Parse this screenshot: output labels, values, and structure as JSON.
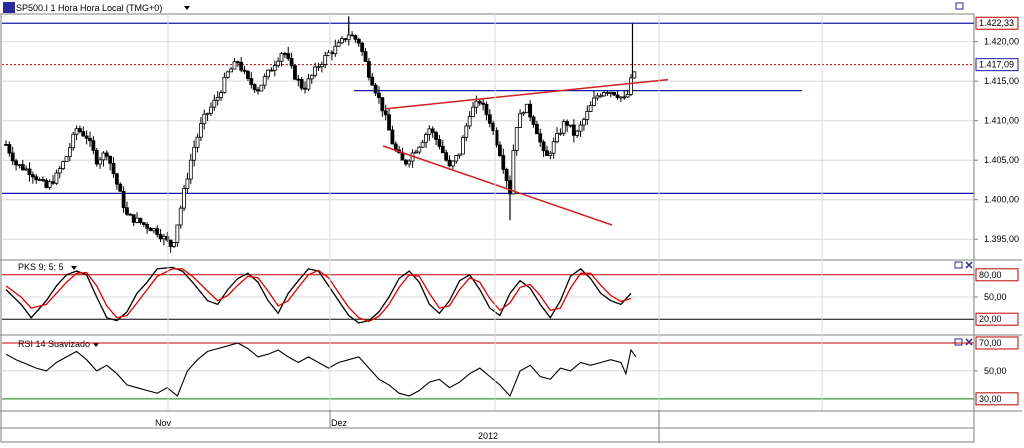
{
  "colors": {
    "grid": "#d8d8d8",
    "frame": "#808080",
    "candle": "#000000",
    "sma": "#e00000",
    "support": "#1a1aa8",
    "trend": "#d02020",
    "level_red": "#c00000",
    "level_green": "#008000",
    "label_blue": "#1a1aa8",
    "label_red": "#c00000",
    "close_dotted": "#c00000"
  },
  "header": {
    "title": "SP500.I 1 Hora Hora Local (TMG+0)",
    "icon": "instrument-icon",
    "menu_icon": "dropdown-arrow-icon"
  },
  "chart_data": [
    {
      "type": "candlestick",
      "name": "SP500.I",
      "ylim": [
        1392.5,
        1423.5
      ],
      "y_ticks": [
        "1.395,00",
        "1.400,00",
        "1.405,00",
        "1.410,00",
        "1.415,00",
        "1.420,00"
      ],
      "y_tick_values": [
        1395,
        1400,
        1405,
        1410,
        1415,
        1420
      ],
      "highlighted_labels": [
        {
          "text": "1.422,33",
          "value": 1422.33,
          "style": "red"
        },
        {
          "text": "1.417,09",
          "value": 1417.09,
          "style": "blue"
        }
      ],
      "horizontal_levels": [
        1422.33,
        1400.8
      ],
      "close_level": 1417.09,
      "partial_support": {
        "value": 1413.8
      },
      "trend_lines": [
        {
          "from": [
            0.0,
            1411.5
          ],
          "to": [
            1.0,
            1415.2
          ]
        },
        {
          "from": [
            0.0,
            1406.8
          ],
          "to": [
            1.0,
            1396.8
          ]
        }
      ],
      "close_path": [
        [
          0,
          1407.0
        ],
        [
          2,
          1404.5
        ],
        [
          5,
          1403.5
        ],
        [
          8,
          1401.5
        ],
        [
          10,
          1403.0
        ],
        [
          12,
          1405.5
        ],
        [
          14,
          1409.0
        ],
        [
          16,
          1408.0
        ],
        [
          18,
          1405.0
        ],
        [
          20,
          1406.0
        ],
        [
          22,
          1402.0
        ],
        [
          24,
          1398.0
        ],
        [
          27,
          1397.0
        ],
        [
          30,
          1396.0
        ],
        [
          33,
          1394.0
        ],
        [
          35,
          1400.0
        ],
        [
          37,
          1406.0
        ],
        [
          39,
          1410.0
        ],
        [
          42,
          1413.0
        ],
        [
          44,
          1416.0
        ],
        [
          46,
          1417.5
        ],
        [
          48,
          1415.0
        ],
        [
          50,
          1414.0
        ],
        [
          53,
          1417.0
        ],
        [
          55,
          1419.0
        ],
        [
          57,
          1416.0
        ],
        [
          59,
          1414.0
        ],
        [
          62,
          1417.0
        ],
        [
          64,
          1418.5
        ],
        [
          66,
          1419.5
        ],
        [
          68,
          1421.0
        ],
        [
          70,
          1420.0
        ],
        [
          72,
          1416.0
        ],
        [
          73,
          1414.5
        ],
        [
          75,
          1411.0
        ],
        [
          77,
          1406.5
        ],
        [
          79,
          1404.5
        ],
        [
          82,
          1407.0
        ],
        [
          84,
          1409.0
        ],
        [
          86,
          1407.0
        ],
        [
          88,
          1404.0
        ],
        [
          90,
          1406.0
        ],
        [
          92,
          1411.0
        ],
        [
          94,
          1412.5
        ],
        [
          96,
          1410.0
        ],
        [
          98,
          1406.0
        ],
        [
          100,
          1401.0
        ],
        [
          101,
          1409.0
        ],
        [
          103,
          1412.0
        ],
        [
          105,
          1409.5
        ],
        [
          107,
          1405.0
        ],
        [
          109,
          1407.5
        ],
        [
          111,
          1410.0
        ],
        [
          113,
          1408.0
        ],
        [
          115,
          1410.5
        ],
        [
          117,
          1413.0
        ],
        [
          119,
          1414.0
        ],
        [
          121,
          1413.5
        ],
        [
          123,
          1412.5
        ],
        [
          124,
          1415.0
        ],
        [
          125,
          1416.8
        ]
      ]
    },
    {
      "type": "line",
      "name": "PKS 9; 5; 5",
      "ylim": [
        0,
        100
      ],
      "y_ticks": [
        "50,00"
      ],
      "y_tick_values": [
        50
      ],
      "highlighted_labels": [
        {
          "text": "80,00",
          "value": 80,
          "style": "red-box"
        },
        {
          "text": "20,00",
          "value": 20,
          "style": "red-box"
        }
      ],
      "levels": [
        {
          "value": 80,
          "color": "red"
        },
        {
          "value": 20,
          "color": "black"
        }
      ],
      "series": [
        {
          "points": [
            [
              0,
              60
            ],
            [
              3,
              40
            ],
            [
              5,
              22
            ],
            [
              8,
              45
            ],
            [
              10,
              65
            ],
            [
              12,
              80
            ],
            [
              14,
              85
            ],
            [
              16,
              80
            ],
            [
              18,
              50
            ],
            [
              20,
              22
            ],
            [
              22,
              18
            ],
            [
              24,
              30
            ],
            [
              26,
              55
            ],
            [
              28,
              70
            ],
            [
              30,
              88
            ],
            [
              33,
              90
            ],
            [
              35,
              85
            ],
            [
              37,
              70
            ],
            [
              40,
              45
            ],
            [
              42,
              40
            ],
            [
              44,
              60
            ],
            [
              46,
              75
            ],
            [
              48,
              82
            ],
            [
              50,
              70
            ],
            [
              52,
              45
            ],
            [
              54,
              28
            ],
            [
              56,
              55
            ],
            [
              58,
              72
            ],
            [
              60,
              88
            ],
            [
              62,
              85
            ],
            [
              64,
              65
            ],
            [
              66,
              45
            ],
            [
              68,
              25
            ],
            [
              70,
              15
            ],
            [
              72,
              18
            ],
            [
              74,
              30
            ],
            [
              76,
              50
            ],
            [
              78,
              75
            ],
            [
              80,
              85
            ],
            [
              82,
              70
            ],
            [
              84,
              40
            ],
            [
              86,
              28
            ],
            [
              88,
              45
            ],
            [
              90,
              72
            ],
            [
              92,
              80
            ],
            [
              94,
              60
            ],
            [
              96,
              35
            ],
            [
              98,
              25
            ],
            [
              100,
              55
            ],
            [
              102,
              72
            ],
            [
              104,
              62
            ],
            [
              106,
              40
            ],
            [
              108,
              22
            ],
            [
              110,
              45
            ],
            [
              112,
              78
            ],
            [
              114,
              88
            ],
            [
              116,
              75
            ],
            [
              118,
              55
            ],
            [
              120,
              45
            ],
            [
              122,
              40
            ],
            [
              124,
              55
            ]
          ]
        },
        {
          "points": [
            [
              0,
              65
            ],
            [
              3,
              50
            ],
            [
              5,
              35
            ],
            [
              8,
              40
            ],
            [
              10,
              55
            ],
            [
              12,
              70
            ],
            [
              14,
              82
            ],
            [
              16,
              83
            ],
            [
              18,
              65
            ],
            [
              20,
              38
            ],
            [
              22,
              22
            ],
            [
              24,
              25
            ],
            [
              26,
              42
            ],
            [
              28,
              60
            ],
            [
              30,
              78
            ],
            [
              33,
              88
            ],
            [
              35,
              88
            ],
            [
              37,
              78
            ],
            [
              40,
              58
            ],
            [
              42,
              45
            ],
            [
              44,
              52
            ],
            [
              46,
              66
            ],
            [
              48,
              78
            ],
            [
              50,
              76
            ],
            [
              52,
              58
            ],
            [
              54,
              38
            ],
            [
              56,
              45
            ],
            [
              58,
              63
            ],
            [
              60,
              80
            ],
            [
              62,
              86
            ],
            [
              64,
              76
            ],
            [
              66,
              56
            ],
            [
              68,
              36
            ],
            [
              70,
              22
            ],
            [
              72,
              17
            ],
            [
              74,
              24
            ],
            [
              76,
              40
            ],
            [
              78,
              63
            ],
            [
              80,
              80
            ],
            [
              82,
              78
            ],
            [
              84,
              55
            ],
            [
              86,
              35
            ],
            [
              88,
              38
            ],
            [
              90,
              60
            ],
            [
              92,
              76
            ],
            [
              94,
              70
            ],
            [
              96,
              48
            ],
            [
              98,
              32
            ],
            [
              100,
              42
            ],
            [
              102,
              63
            ],
            [
              104,
              67
            ],
            [
              106,
              52
            ],
            [
              108,
              32
            ],
            [
              110,
              35
            ],
            [
              112,
              62
            ],
            [
              114,
              82
            ],
            [
              116,
              82
            ],
            [
              118,
              66
            ],
            [
              120,
              52
            ],
            [
              122,
              44
            ],
            [
              124,
              48
            ]
          ]
        }
      ]
    },
    {
      "type": "line",
      "name": "RSI 14 Suavizado",
      "ylim": [
        22,
        75
      ],
      "y_ticks": [
        "50,00"
      ],
      "y_tick_values": [
        50
      ],
      "highlighted_labels": [
        {
          "text": "70,00",
          "value": 70,
          "style": "red-box"
        },
        {
          "text": "30,00",
          "value": 30,
          "style": "red-box"
        }
      ],
      "levels": [
        {
          "value": 70,
          "color": "red"
        },
        {
          "value": 30,
          "color": "green"
        }
      ],
      "series": [
        {
          "points": [
            [
              0,
              62
            ],
            [
              2,
              58
            ],
            [
              4,
              55
            ],
            [
              6,
              52
            ],
            [
              8,
              50
            ],
            [
              10,
              56
            ],
            [
              12,
              60
            ],
            [
              14,
              64
            ],
            [
              16,
              58
            ],
            [
              18,
              50
            ],
            [
              20,
              54
            ],
            [
              22,
              48
            ],
            [
              24,
              40
            ],
            [
              26,
              38
            ],
            [
              28,
              36
            ],
            [
              30,
              34
            ],
            [
              32,
              38
            ],
            [
              34,
              32
            ],
            [
              36,
              50
            ],
            [
              38,
              58
            ],
            [
              40,
              64
            ],
            [
              42,
              66
            ],
            [
              44,
              68
            ],
            [
              46,
              70
            ],
            [
              48,
              66
            ],
            [
              50,
              60
            ],
            [
              52,
              62
            ],
            [
              54,
              65
            ],
            [
              56,
              60
            ],
            [
              58,
              56
            ],
            [
              60,
              60
            ],
            [
              62,
              56
            ],
            [
              64,
              52
            ],
            [
              66,
              56
            ],
            [
              68,
              58
            ],
            [
              70,
              60
            ],
            [
              72,
              52
            ],
            [
              74,
              44
            ],
            [
              76,
              40
            ],
            [
              78,
              34
            ],
            [
              80,
              32
            ],
            [
              82,
              36
            ],
            [
              84,
              42
            ],
            [
              86,
              44
            ],
            [
              88,
              38
            ],
            [
              90,
              42
            ],
            [
              92,
              48
            ],
            [
              94,
              52
            ],
            [
              96,
              46
            ],
            [
              98,
              40
            ],
            [
              100,
              32
            ],
            [
              102,
              50
            ],
            [
              104,
              54
            ],
            [
              106,
              46
            ],
            [
              108,
              44
            ],
            [
              110,
              52
            ],
            [
              112,
              50
            ],
            [
              114,
              56
            ],
            [
              116,
              54
            ],
            [
              118,
              56
            ],
            [
              120,
              58
            ],
            [
              122,
              56
            ],
            [
              123,
              48
            ],
            [
              124,
              65
            ],
            [
              125,
              60
            ]
          ]
        }
      ]
    }
  ],
  "panels": {
    "pks_label": "PKS 9; 5; 5",
    "rsi_label": "RSI 14 Suavizado"
  },
  "x_axis": {
    "month_labels": [
      "Nov",
      "Dez"
    ],
    "year_label": "2012"
  },
  "window_icons": {
    "restore": "restore-icon",
    "close": "close-icon"
  }
}
